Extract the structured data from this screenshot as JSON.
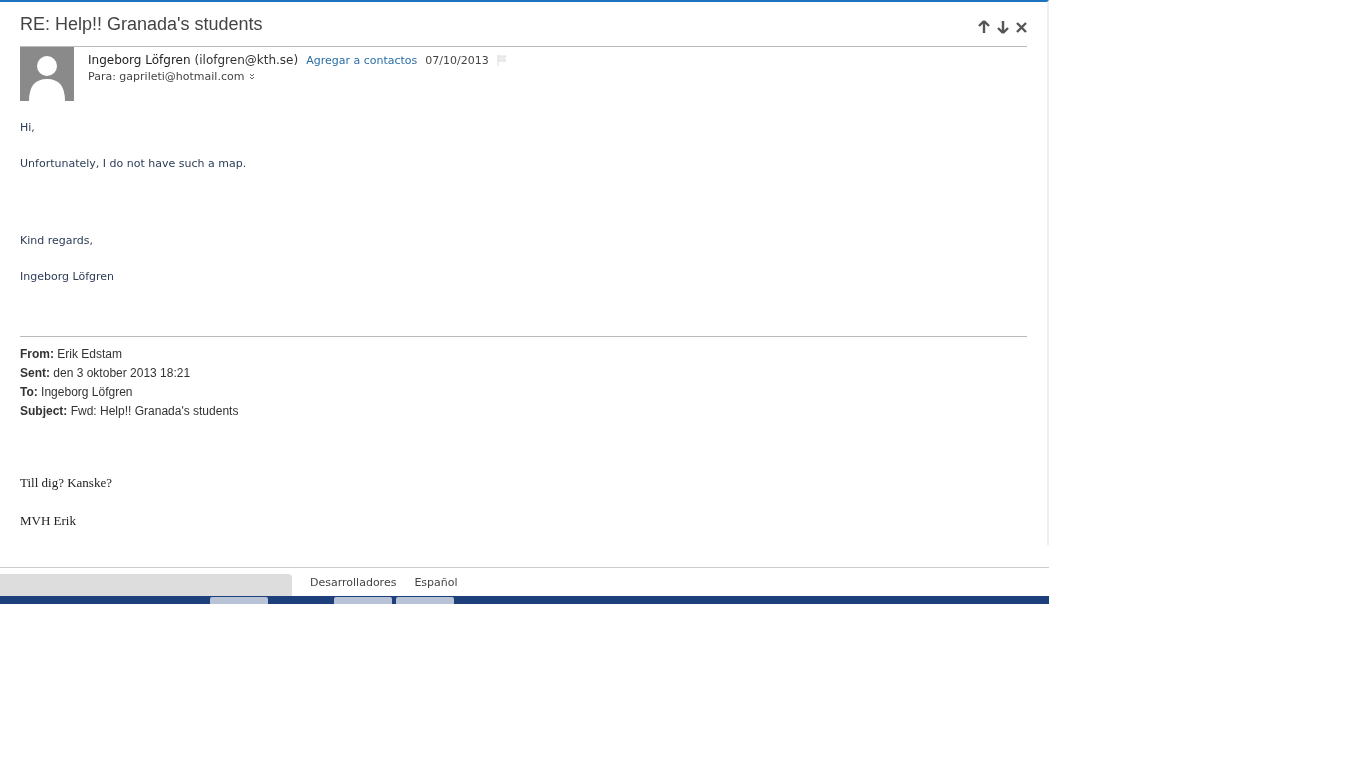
{
  "message": {
    "subject": "RE: Help!! Granada's students",
    "sender_name": "Ingeborg Löfgren",
    "sender_email": "(ilofgren@kth.se)",
    "add_contact": "Agregar a contactos",
    "date": "07/10/2013",
    "to": "Para: gaprileti@hotmail.com",
    "body": [
      "Hi,",
      "Unfortunately, I do not have such a map.",
      "Kind regards,",
      "Ingeborg Löfgren"
    ],
    "quoted_header": [
      {
        "label": "From:",
        "value": "Erik Edstam"
      },
      {
        "label": "Sent:",
        "value": "den 3 oktober 2013 18:21"
      },
      {
        "label": "To:",
        "value": "Ingeborg Löfgren"
      },
      {
        "label": "Subject:",
        "value": "Fwd: Help!! Granada's students"
      }
    ],
    "quoted_body": [
      "Till dig? Kanske?",
      "MVH Erik"
    ]
  },
  "footer": {
    "links": [
      "Desarrolladores",
      "Español"
    ]
  }
}
